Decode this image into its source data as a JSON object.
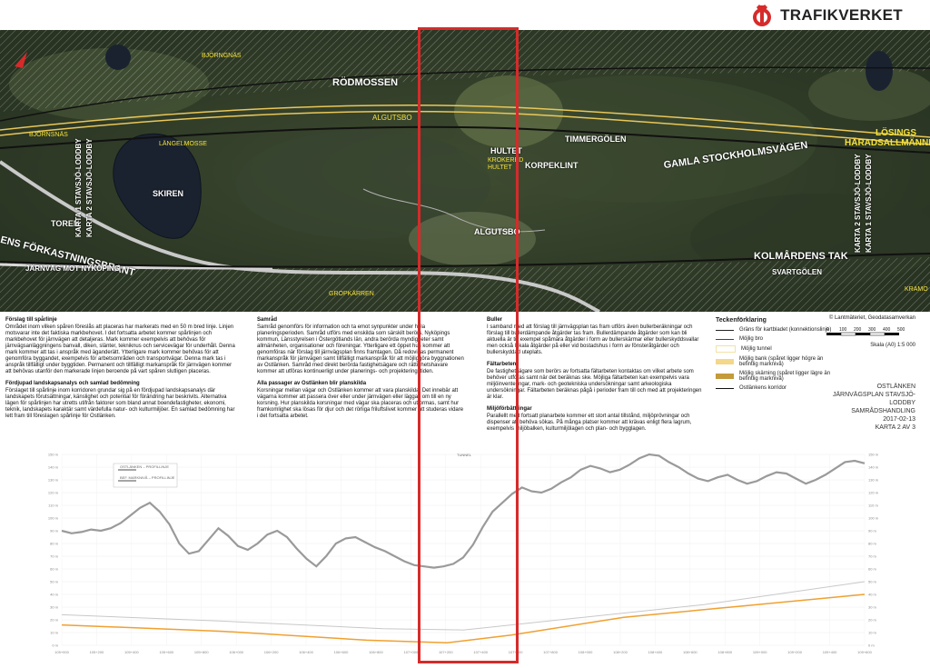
{
  "logo": {
    "text": "TRAFIKVERKET",
    "brand_color": "#d62b2b"
  },
  "map": {
    "place_names": {
      "bjorngnas": "BJÖRNGNÄS",
      "rodmossen": "RÖDMOSSEN",
      "bjornsnas": "BJÖRNSNÄS",
      "skiren": "SKIREN",
      "algutsbo_n": "ALGUTSBO",
      "hultet": "HULTET",
      "korpeklint": "KORPEKLINT",
      "timmergolen": "TIMMERGÖLEN",
      "gamla_vagen": "GAMLA STOCKHOLMSVÄGEN",
      "losings": "LÖSINGS",
      "haradsallmanning": "HÄRADSALLMÄNNING",
      "toren": "TOREN",
      "karta1": "KARTA 1 STAVSJÖ-LODDBY",
      "karta2_w": "KARTA 2 STAVSJÖ-LODDBY",
      "karta2_e": "KARTA 2 STAVSJÖ-LODDBY",
      "karta1_e": "KARTA 1 STAVSJÖ-LODDBY",
      "algutsbo_s": "ALGUTSBO",
      "kolmardens_tak": "KOLMÅRDENS TAK",
      "svartgolen": "SVARTGÖLEN",
      "forkastningsbrant": "ENS FÖRKASTNINGSBRANT",
      "jarnvag": "JÄRNVÄG MOT NYKÖPING",
      "gropkarren": "GROPKÄRREN",
      "kramo": "KRAMO",
      "langelmosse": "LÄNGELMOSSE",
      "krokered": "KROKERED",
      "hultet_y": "HULTET"
    }
  },
  "text_columns": {
    "col1": {
      "h1": "Förslag till spårlinje",
      "p1": "Området inom vilken spåren föreslås att placeras har markerats med en 50 m bred linje. Linjen motsvarar inte det faktiska markbehovet. I det fortsatta arbetet kommer spårlinjen och markbehovet för järnvägen att detaljeras. Mark kommer exempelvis att behövas för järnvägsanläggningens banvall, diken, slänter, tekniknus och servicevägar för underhåll. Denna mark kommer att tas i anspråk med äganderätt. Ytterligare mark kommer behövas för att genomföra byggandet, exempelvis för arbetsområden och transportvägar. Denna mark tas i anspråk tillfälligt under byggtiden. Permanent och tillfälligt markanspråk för järnvägen kommer att behövas utanför den markerade linjen beroende på vart spåren slutligen placeras.",
      "h2": "Fördjupad landskapsanalys och samlad bedömning",
      "p2": "Förslaget till spårlinje inom korridoren grundar sig på en fördjupad landskapsanalys där landskapets förutsättningar, känslighet och potential för förändring har beskrivits. Alternativa lägen för spårlinjen har utretts utifrån faktorer som bland annat boendefastigheter, ekonomi, teknik, landskapets karaktär samt värdefulla natur- och kulturmiljöer. En samlad bedömning har lett fram till föreslagen spårlinje för Ostlänken."
    },
    "col2": {
      "h1": "Samråd",
      "p1": "Samråd genomförs för information och ta emot synpunkter under hela planeringsperioden. Samråd utförs med enskilda som särskilt berörs, Nyköpings kommun, Länsstyrelsen i Östergötlands län, andra berörda myndigheter samt allmänheten, organisationer och föreningar. Ytterligare ett öppet hus kommer att genomföras när förslag till järnvägsplan finns framtagen. Då redovisas permanent markanspråk för järnvägen samt tillfälligt markanspråk för att möjliggöra byggnationen av Ostlänken. Samråd med direkt berörda fastighetsägare och rättighetshavare kommer att utföras kontinuerligt under planerings- och projekteringstiden.",
      "h2": "Alla passager av Ostlänken blir planskilda",
      "p2": "Korsningar mellan vägar och Ostlänken kommer att vara planskilda. Det innebär att vägarna kommer att passera över eller under järnvägen eller läggas om till en ny korsning. Hur planskilda korsningar med vägar ska placeras och utformas, samt hur framkomlighet ska lösas för djur och det rörliga friluftslivet kommer att studeras vidare i det fortsatta arbetet."
    },
    "col3": {
      "h1": "Buller",
      "p1": "I samband med att förslag till järnvägsplan tas fram utförs även bullerberäkningar och förslag till bullerdämpande åtgärder tas fram. Bullerdämpande åtgärder som kan bli aktuella är till exempel spåmära åtgärder i form av bullerskärmar eller bullerskyddsvallar men också lokala åtgärder på eller vid bostadshus i form av fönsteråtgärder och bullerskyddad uteplats.",
      "h2": "Fältarbeten",
      "p2": "De fastighetsägare som berörs av fortsatta fältarbeten kontaktas om vilket arbete som behöver utföras samt när det beräknas ske. Möjliga fältarbeten kan exempelvis vara miljöinventeringar, mark- och geotekniska undersökningar samt arkeologiska undersökningar. Fältarbeten beräknas pågå i perioder fram till och med att projekteringen är klar.",
      "h3": "Miljöförbättringar",
      "p3": "Parallellt med fortsatt planarbete kommer ett stort antal tillstånd, miljöprövningar och dispenser att behöva sökas. På många platser kommer att krävas enligt flera lagrum, exempelvis miljöbalken, kulturmiljölagen och plan- och bygglagen."
    }
  },
  "legend": {
    "title": "Teckenförklaring",
    "items": [
      {
        "label": "Gräns för kartbladet (konnektionslinje)",
        "color": "#222222"
      },
      {
        "label": "Möjlig bro",
        "color": "#444444"
      },
      {
        "label": "Möjlig tunnel",
        "color": "#f2e2a4"
      },
      {
        "label": "Möjlig bank (spåret ligger högre än befintlig marknivå)",
        "color": "#f3d88a"
      },
      {
        "label": "Möjlig skärning (spåret ligger lägre än befintlig marknivå)",
        "color": "#c49a3a"
      },
      {
        "label": "Ostlänkens korridor",
        "color": "#111111"
      }
    ]
  },
  "info": {
    "copyright": "© Lantmäteriet, Geodatasamverkan",
    "scale_ticks": [
      "0",
      "100",
      "200",
      "300",
      "400",
      "500"
    ],
    "scale_text": "Skala (A0) 1:5 000",
    "line1": "OSTLÄNKEN",
    "line2": "JÄRNVÄGSPLAN STAVSJÖ-LODDBY",
    "line3": "SAMRÅDSHANDLING",
    "line4": "2017-02-13",
    "line5": "KARTA 2 AV 3"
  },
  "profile": {
    "legend_1": "OSTLÄNKEN – PROFILLINJE",
    "legend_2": "BEF. MARKNIVÅ – PROFILLINJE",
    "tunnel_label": "TUNNEL",
    "y_ticks": [
      "150 m",
      "140 m",
      "130 m",
      "120 m",
      "110 m",
      "100 m",
      "90 m",
      "80 m",
      "70 m",
      "60 m",
      "50 m",
      "40 m",
      "30 m",
      "20 m",
      "10 m",
      "0 m"
    ],
    "x_ticks": [
      "105+000",
      "105+200",
      "105+400",
      "105+600",
      "105+800",
      "106+000",
      "106+200",
      "106+400",
      "106+600",
      "106+800",
      "107+000",
      "107+200",
      "107+400",
      "107+600",
      "107+800",
      "108+000",
      "108+200",
      "108+400",
      "108+600",
      "108+800",
      "109+000",
      "109+200",
      "109+400",
      "109+600"
    ],
    "colors": {
      "terrain": "#9a9a9a",
      "track": "#f0a030",
      "ref": "#c8c8c8"
    },
    "terrain_values": [
      90,
      88,
      89,
      91,
      90,
      92,
      96,
      102,
      108,
      112,
      105,
      95,
      80,
      72,
      74,
      83,
      92,
      86,
      78,
      75,
      80,
      87,
      90,
      85,
      76,
      68,
      62,
      70,
      80,
      84,
      85,
      81,
      77,
      74,
      70,
      66,
      63,
      62,
      61,
      62,
      64,
      69,
      79,
      93,
      105,
      112,
      119,
      124,
      121,
      120,
      123,
      128,
      132,
      138,
      141,
      139,
      136,
      138,
      142,
      147,
      150,
      149,
      144,
      140,
      135,
      131,
      129,
      132,
      134,
      130,
      127,
      129,
      133,
      136,
      135,
      131,
      127,
      130,
      134,
      139,
      144,
      145,
      143
    ]
  }
}
